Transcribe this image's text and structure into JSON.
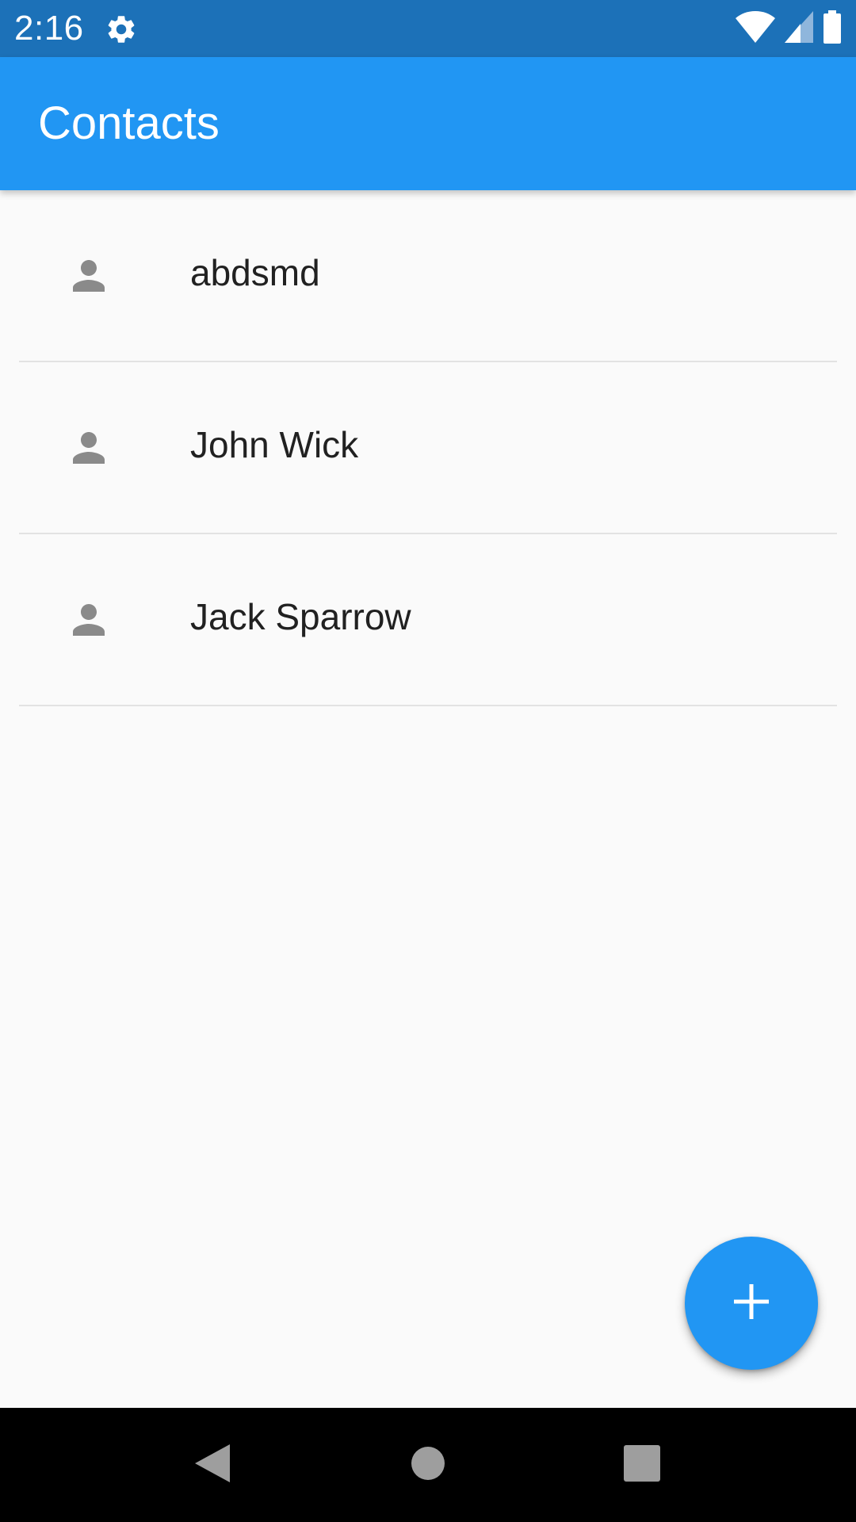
{
  "status_bar": {
    "time": "2:16",
    "icons": [
      "gear-icon",
      "wifi-icon",
      "signal-icon",
      "battery-icon"
    ],
    "color": "#1c71b8"
  },
  "app_bar": {
    "title": "Contacts",
    "color": "#2196f3"
  },
  "contacts": [
    {
      "name": "abdsmd",
      "icon": "person-icon"
    },
    {
      "name": "John Wick",
      "icon": "person-icon"
    },
    {
      "name": "Jack Sparrow",
      "icon": "person-icon"
    }
  ],
  "fab": {
    "icon": "plus-icon",
    "color": "#2196f3"
  },
  "nav_bar": {
    "buttons": [
      "back-icon",
      "home-icon",
      "recents-icon"
    ]
  }
}
